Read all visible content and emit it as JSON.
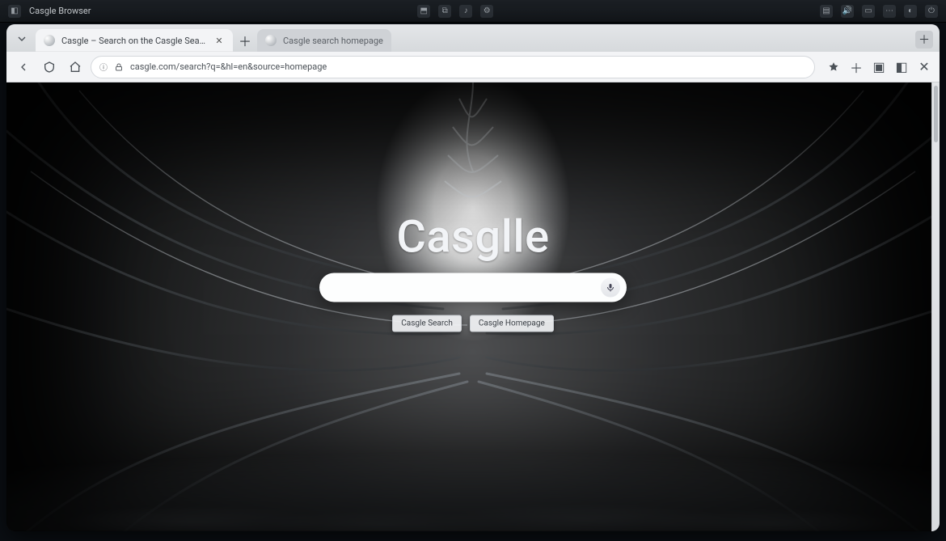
{
  "os": {
    "app_name": "Casgle Browser"
  },
  "tabs": {
    "active": {
      "label": "Casgle – Search on the Casgle Search"
    },
    "inactive": {
      "label": "Casgle search homepage"
    }
  },
  "toolbar": {
    "url": "casgle.com/search?q=&hl=en&source=homepage"
  },
  "page": {
    "brand": "Casglle",
    "search": {
      "placeholder": "",
      "value": ""
    },
    "buttons": {
      "primary": "Casgle Search",
      "secondary": "Casgle Homepage"
    }
  }
}
